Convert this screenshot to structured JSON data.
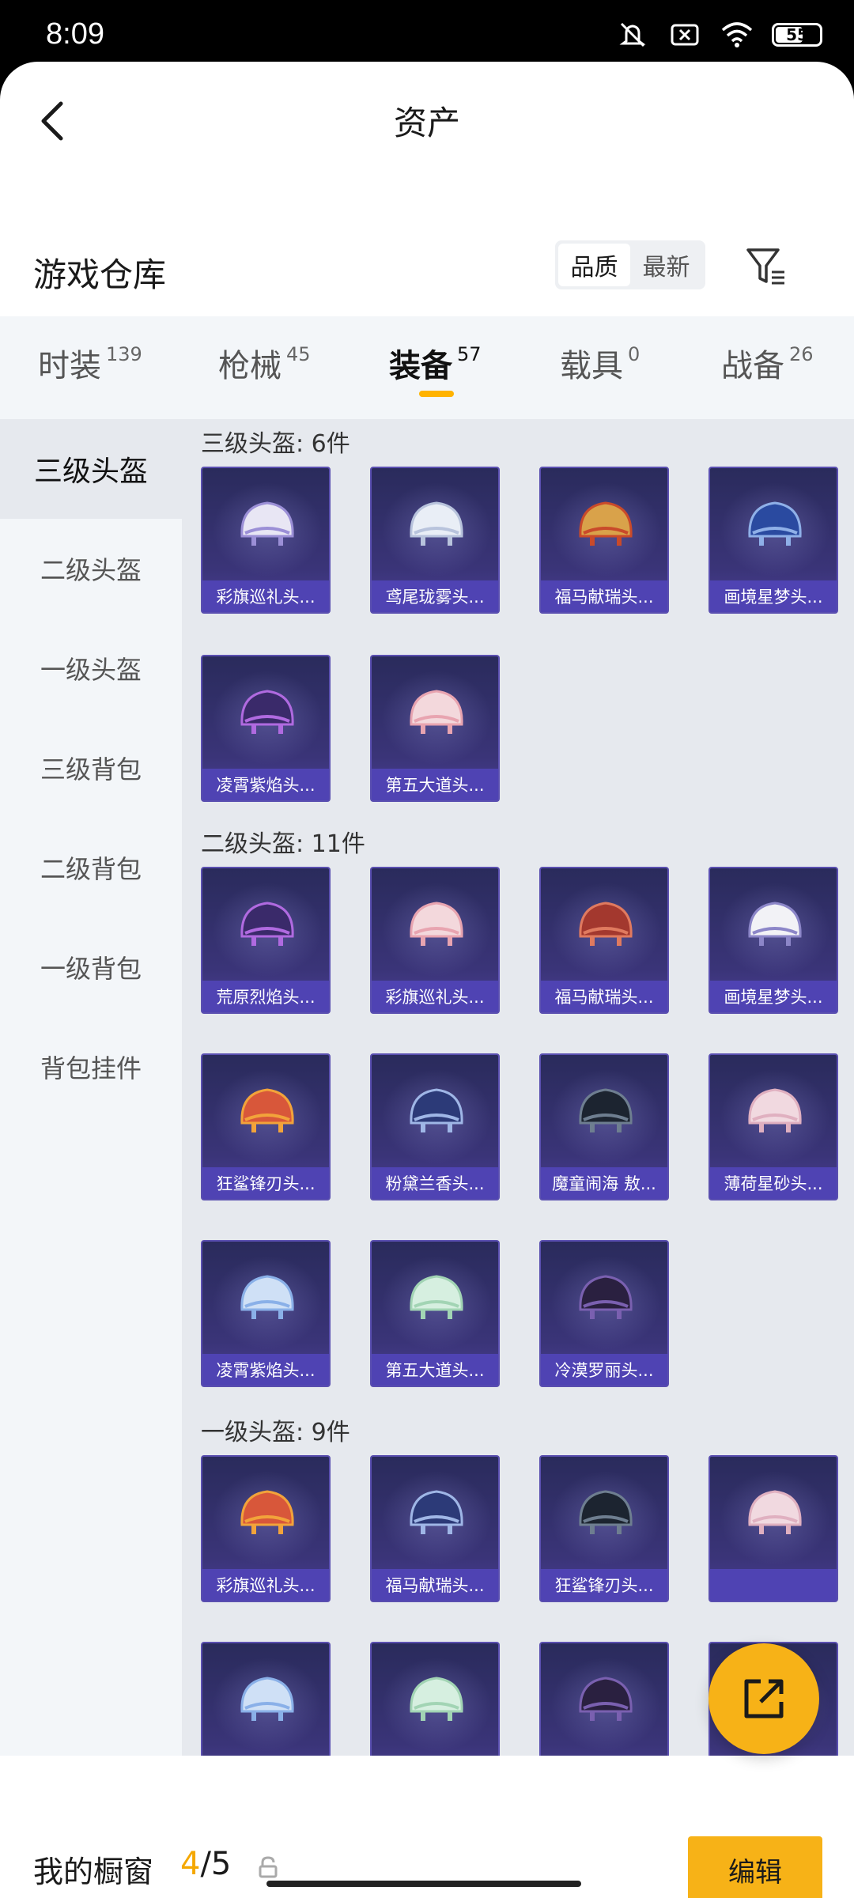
{
  "status": {
    "time": "8:09",
    "battery": "55"
  },
  "nav": {
    "title": "资产"
  },
  "warehouse": {
    "title": "游戏仓库",
    "sort_options": [
      "品质",
      "最新"
    ]
  },
  "tabs": [
    {
      "label": "时装",
      "count": "139"
    },
    {
      "label": "枪械",
      "count": "45"
    },
    {
      "label": "装备",
      "count": "57"
    },
    {
      "label": "载具",
      "count": "0"
    },
    {
      "label": "战备",
      "count": "26"
    }
  ],
  "sidebar": [
    "三级头盔",
    "二级头盔",
    "一级头盔",
    "三级背包",
    "二级背包",
    "一级背包",
    "背包挂件"
  ],
  "sections": [
    {
      "title": "三级头盔: 6件",
      "items": [
        "彩旗巡礼头...",
        "鸢尾珑雾头...",
        "福马献瑞头...",
        "画境星梦头...",
        "凌霄紫焰头...",
        "第五大道头..."
      ]
    },
    {
      "title": "二级头盔: 11件",
      "items": [
        "荒原烈焰头...",
        "彩旗巡礼头...",
        "福马献瑞头...",
        "画境星梦头...",
        "狂鲨锋刃头...",
        "粉黛兰香头...",
        "魔童闹海 敖...",
        "薄荷星砂头...",
        "凌霄紫焰头...",
        "第五大道头...",
        "冷漠罗丽头..."
      ]
    },
    {
      "title": "一级头盔: 9件",
      "items": [
        "彩旗巡礼头...",
        "福马献瑞头...",
        "狂鲨锋刃头...",
        "",
        "",
        "",
        "",
        ""
      ]
    }
  ],
  "bottom": {
    "label": "我的橱窗",
    "current": "4",
    "total": "/5",
    "edit": "编辑"
  },
  "colors": {
    "accent": "#f7b217",
    "card_name_bg": "#4f43b3"
  }
}
